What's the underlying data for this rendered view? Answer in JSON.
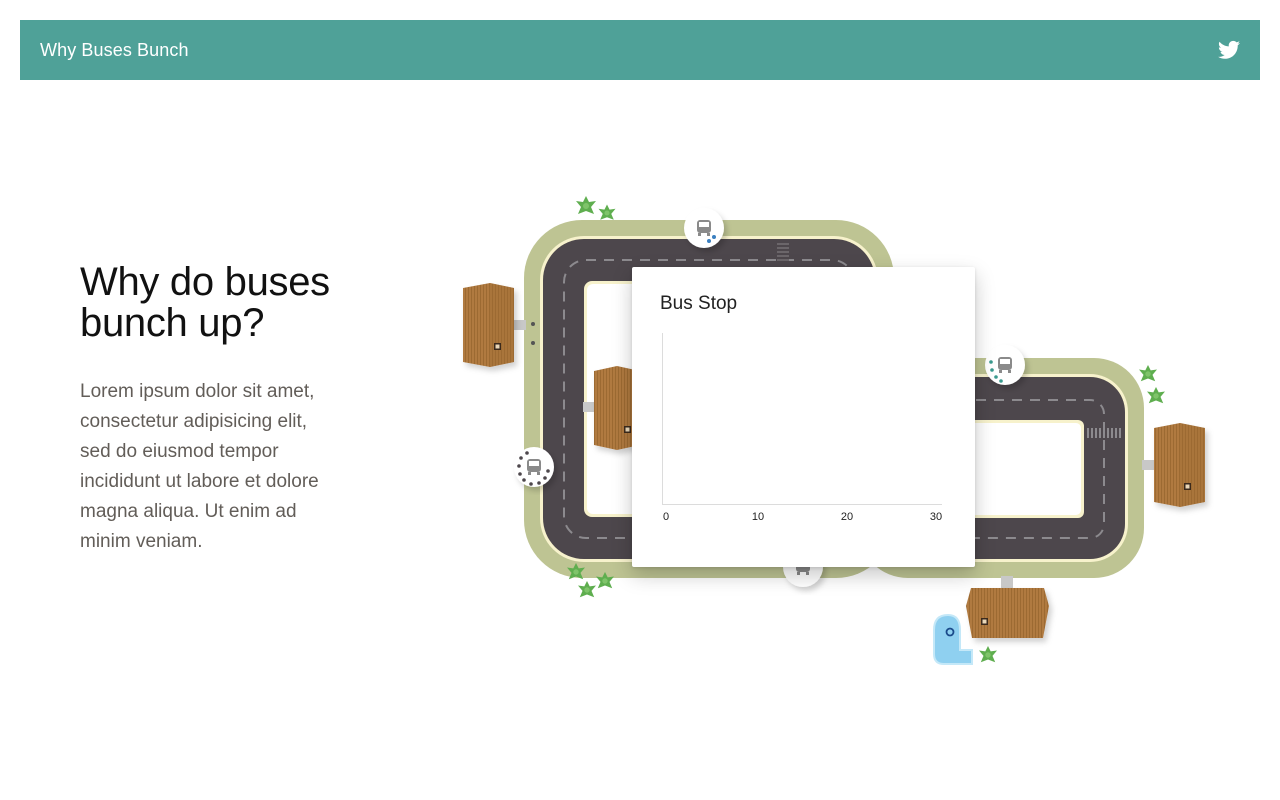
{
  "header": {
    "title": "Why Buses Bunch",
    "share_icon": "twitter-icon"
  },
  "intro": {
    "heading_line1": "Why do buses",
    "heading_line2": "bunch up?",
    "body": "Lorem ipsum dolor sit amet, consectetur adipisicing elit, sed do eiusmod tempor incididunt ut labore et dolore magna aliqua. Ut enim ad minim veniam."
  },
  "card": {
    "title": "Bus Stop",
    "x_ticks": [
      "0",
      "10",
      "20",
      "30"
    ]
  },
  "colors": {
    "header": "#4fa198",
    "road": "#4d474c",
    "grass": "#bec493",
    "building": "#b07a40",
    "pond": "#8fd0f0",
    "tree": "#5fae4f"
  }
}
